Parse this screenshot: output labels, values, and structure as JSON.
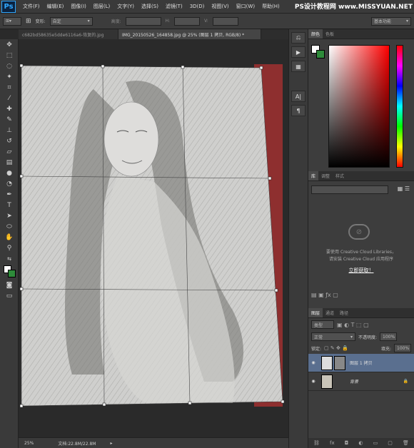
{
  "app": {
    "logo": "Ps",
    "watermark": "PS设计教程网 www.MISSYUAN.NET"
  },
  "menu": [
    "文件(F)",
    "编辑(E)",
    "图像(I)",
    "图层(L)",
    "文字(Y)",
    "选择(S)",
    "滤镜(T)",
    "3D(D)",
    "视图(V)",
    "窗口(W)",
    "帮助(H)"
  ],
  "options": {
    "transform_label": "变形:",
    "transform_value": "自定",
    "fields": [
      "高度:",
      "H:",
      "V:"
    ],
    "workspace": "基本功能"
  },
  "tabs": [
    {
      "label": "c682bd58635e5dde6116a6-恢复的.jpg",
      "active": false
    },
    {
      "label": "IMG_20150526_164858.jpg @ 25% (图层 1 拷贝, RGB/8) *",
      "active": true
    }
  ],
  "status": {
    "zoom": "25%",
    "doc": "文档:22.8M/22.8M"
  },
  "color_panel": {
    "tabs": [
      "颜色",
      "色板"
    ],
    "fg": "#ffffff",
    "bg": "#2e8b3a"
  },
  "library_panel": {
    "tabs": [
      "库",
      "调整",
      "样式"
    ],
    "message1": "要使用 Creative Cloud Libraries，",
    "message2": "请安装 Creative Cloud 应用程序",
    "link": "立即获取！"
  },
  "layers_panel": {
    "tabs": [
      "图层",
      "通道",
      "路径"
    ],
    "filter": "类型",
    "blend": "正常",
    "opacity_label": "不透明度:",
    "opacity": "100%",
    "lock_label": "锁定:",
    "fill_label": "填充:",
    "fill": "100%",
    "layers": [
      {
        "name": "图层 1 拷贝",
        "selected": true,
        "locked": false
      },
      {
        "name": "背景",
        "selected": false,
        "locked": true
      }
    ]
  },
  "colors": {
    "accent": "#31a8ff",
    "selected_layer": "#5a6f8f"
  }
}
